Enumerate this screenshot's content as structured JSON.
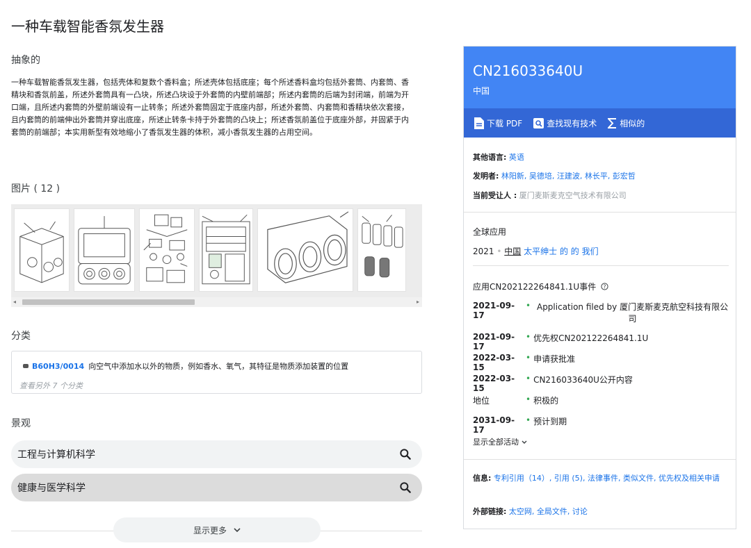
{
  "title": "一种车载智能香氛发生器",
  "abstract": {
    "heading": "抽象的",
    "text": "一种车载智能香氛发生器，包括壳体和复数个香料盒；所述壳体包括底座；每个所述香料盒均包括外套筒、内套筒、香精块和香氛前盖，所述外套筒具有一凸块，所述凸块设于外套筒的内壁前端部；所述内套筒的后端为封闭端，前端为开口端，且所述内套筒的外壁前端设有一止转条；所述外套筒固定于底座内部，所述外套筒、内套筒和香精块依次套接，且内套筒的前端伸出外套筒并穿出底座，所述止转条卡持于外套筒的凸块上；所述香氛前盖位于底座外部，并固紧于内套筒的前端部；本实用新型有效地缩小了香氛发生器的体积，减小香氛发生器的占用空间。"
  },
  "images": {
    "heading": "图片 ( 12 )",
    "thumbnails": [
      "figure-1",
      "figure-2",
      "figure-3",
      "figure-4",
      "figure-5",
      "figure-6"
    ],
    "scroll_left": "◂",
    "scroll_right": "▸"
  },
  "classification": {
    "heading": "分类",
    "code": "B60H3/0014",
    "description": "向空气中添加水以外的物质，例如香水、氧气，其特征是物质添加装置的位置",
    "more": "查看另外 7 个分类"
  },
  "landscape": {
    "heading": "景观",
    "items": [
      {
        "label": "工程与计算机科学"
      },
      {
        "label": "健康与医学科学"
      }
    ],
    "show_more": "显示更多",
    "show_more_icon": "chevron-down-icon"
  },
  "card": {
    "pub_number": "CN216033640U",
    "country": "中国",
    "actions": [
      {
        "label": "下载 PDF",
        "icon": "pdf-icon"
      },
      {
        "label": "查找现有技术",
        "icon": "prior-art-icon"
      },
      {
        "label": "相似的",
        "icon": "sigma-icon"
      }
    ],
    "other_lang_label": "其他语言:",
    "other_lang_value": "英语",
    "inventors_label": "发明者:",
    "inventors_value": "林阳新, 吴德培, 汪建波, 林长平, 彭宏哲",
    "assignee_label": "当前受让人 :",
    "assignee_value": "厦门麦斯麦克空气技术有限公司",
    "global_heading": "全球应用",
    "global_year": "2021",
    "global_country": "中国",
    "global_rest": "太平绅士 的 的 我们",
    "events_heading": "应用CN202122264841.1U事件",
    "events": [
      {
        "date": "2021-09-17",
        "desc": "Application filed by 厦门麦斯麦克航空科技有限公司"
      },
      {
        "date": "2021-09-17",
        "desc": "优先权CN202122264841.1U"
      },
      {
        "date": "2022-03-15",
        "desc": "申请获批准"
      },
      {
        "date": "2022-03-15",
        "desc": "CN216033640U公开内容"
      },
      {
        "date": "地位",
        "desc": "积极的"
      },
      {
        "date": "2031-09-17",
        "desc": "预计到期"
      }
    ],
    "show_all": "显示全部活动",
    "info_label": "信息:",
    "info_value": "专利引用（14）, 引用 (5), 法律事件, 类似文件, 优先权及相关申请",
    "external_label": "外部链接:",
    "external_value": "太空网, 全局文件, 讨论",
    "colors": {
      "header": "#4285f4",
      "actions_bar": "#3367d6",
      "link": "#1a73e8",
      "status_dot": "#34a853"
    }
  }
}
